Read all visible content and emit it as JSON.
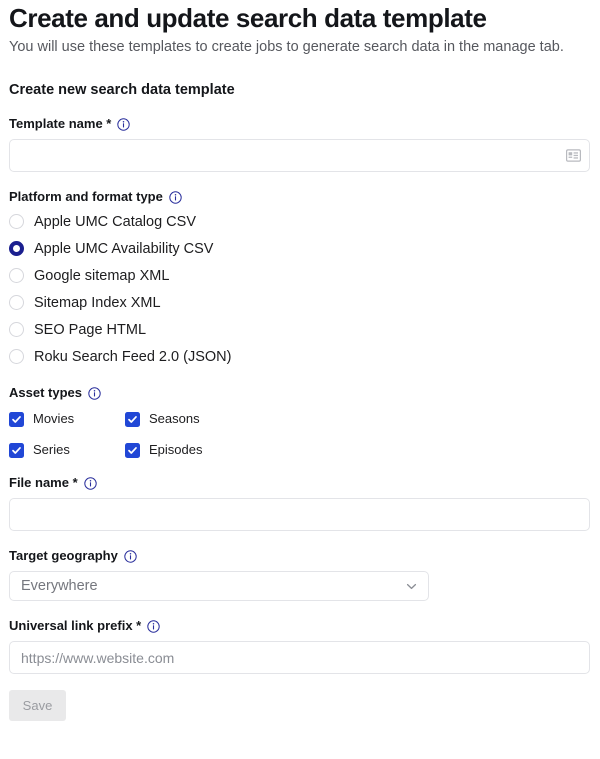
{
  "header": {
    "title": "Create and update search data template",
    "subtitle": "You will use these templates to create jobs to generate search data in the manage tab."
  },
  "section": {
    "title": "Create new search data template"
  },
  "colors": {
    "accent_navy": "#1b1f8f",
    "accent_blue": "#2147d6",
    "border": "#e3e4e8",
    "text": "#1d1d1f",
    "muted": "#56585e",
    "placeholder": "#8a8d94",
    "disabled_bg": "#e9e9ea",
    "disabled_text": "#9a9ca1"
  },
  "fields": {
    "template_name": {
      "label": "Template name *",
      "info_icon": "info-circle-icon",
      "value": "",
      "placeholder": "",
      "trailing_icon": "contact-card-icon"
    },
    "platform_format": {
      "label": "Platform and format type",
      "info_icon": "info-circle-icon",
      "selected": "Apple UMC Availability CSV",
      "options": [
        {
          "label": "Apple UMC Catalog CSV",
          "selected": false
        },
        {
          "label": "Apple UMC Availability CSV",
          "selected": true
        },
        {
          "label": "Google sitemap XML",
          "selected": false
        },
        {
          "label": "Sitemap Index XML",
          "selected": false
        },
        {
          "label": "SEO Page HTML",
          "selected": false
        },
        {
          "label": "Roku Search Feed 2.0 (JSON)",
          "selected": false
        }
      ]
    },
    "asset_types": {
      "label": "Asset types",
      "info_icon": "info-circle-icon",
      "options": [
        {
          "label": "Movies",
          "checked": true
        },
        {
          "label": "Seasons",
          "checked": true
        },
        {
          "label": "Series",
          "checked": true
        },
        {
          "label": "Episodes",
          "checked": true
        }
      ]
    },
    "file_name": {
      "label": "File name *",
      "info_icon": "info-circle-icon",
      "value": "",
      "placeholder": ""
    },
    "target_geography": {
      "label": "Target geography",
      "info_icon": "info-circle-icon",
      "selected_value": "Everywhere",
      "chevron_icon": "chevron-down-icon"
    },
    "universal_link_prefix": {
      "label": "Universal link prefix *",
      "info_icon": "info-circle-icon",
      "value": "",
      "placeholder": "https://www.website.com"
    }
  },
  "actions": {
    "save_label": "Save",
    "save_disabled": true
  }
}
